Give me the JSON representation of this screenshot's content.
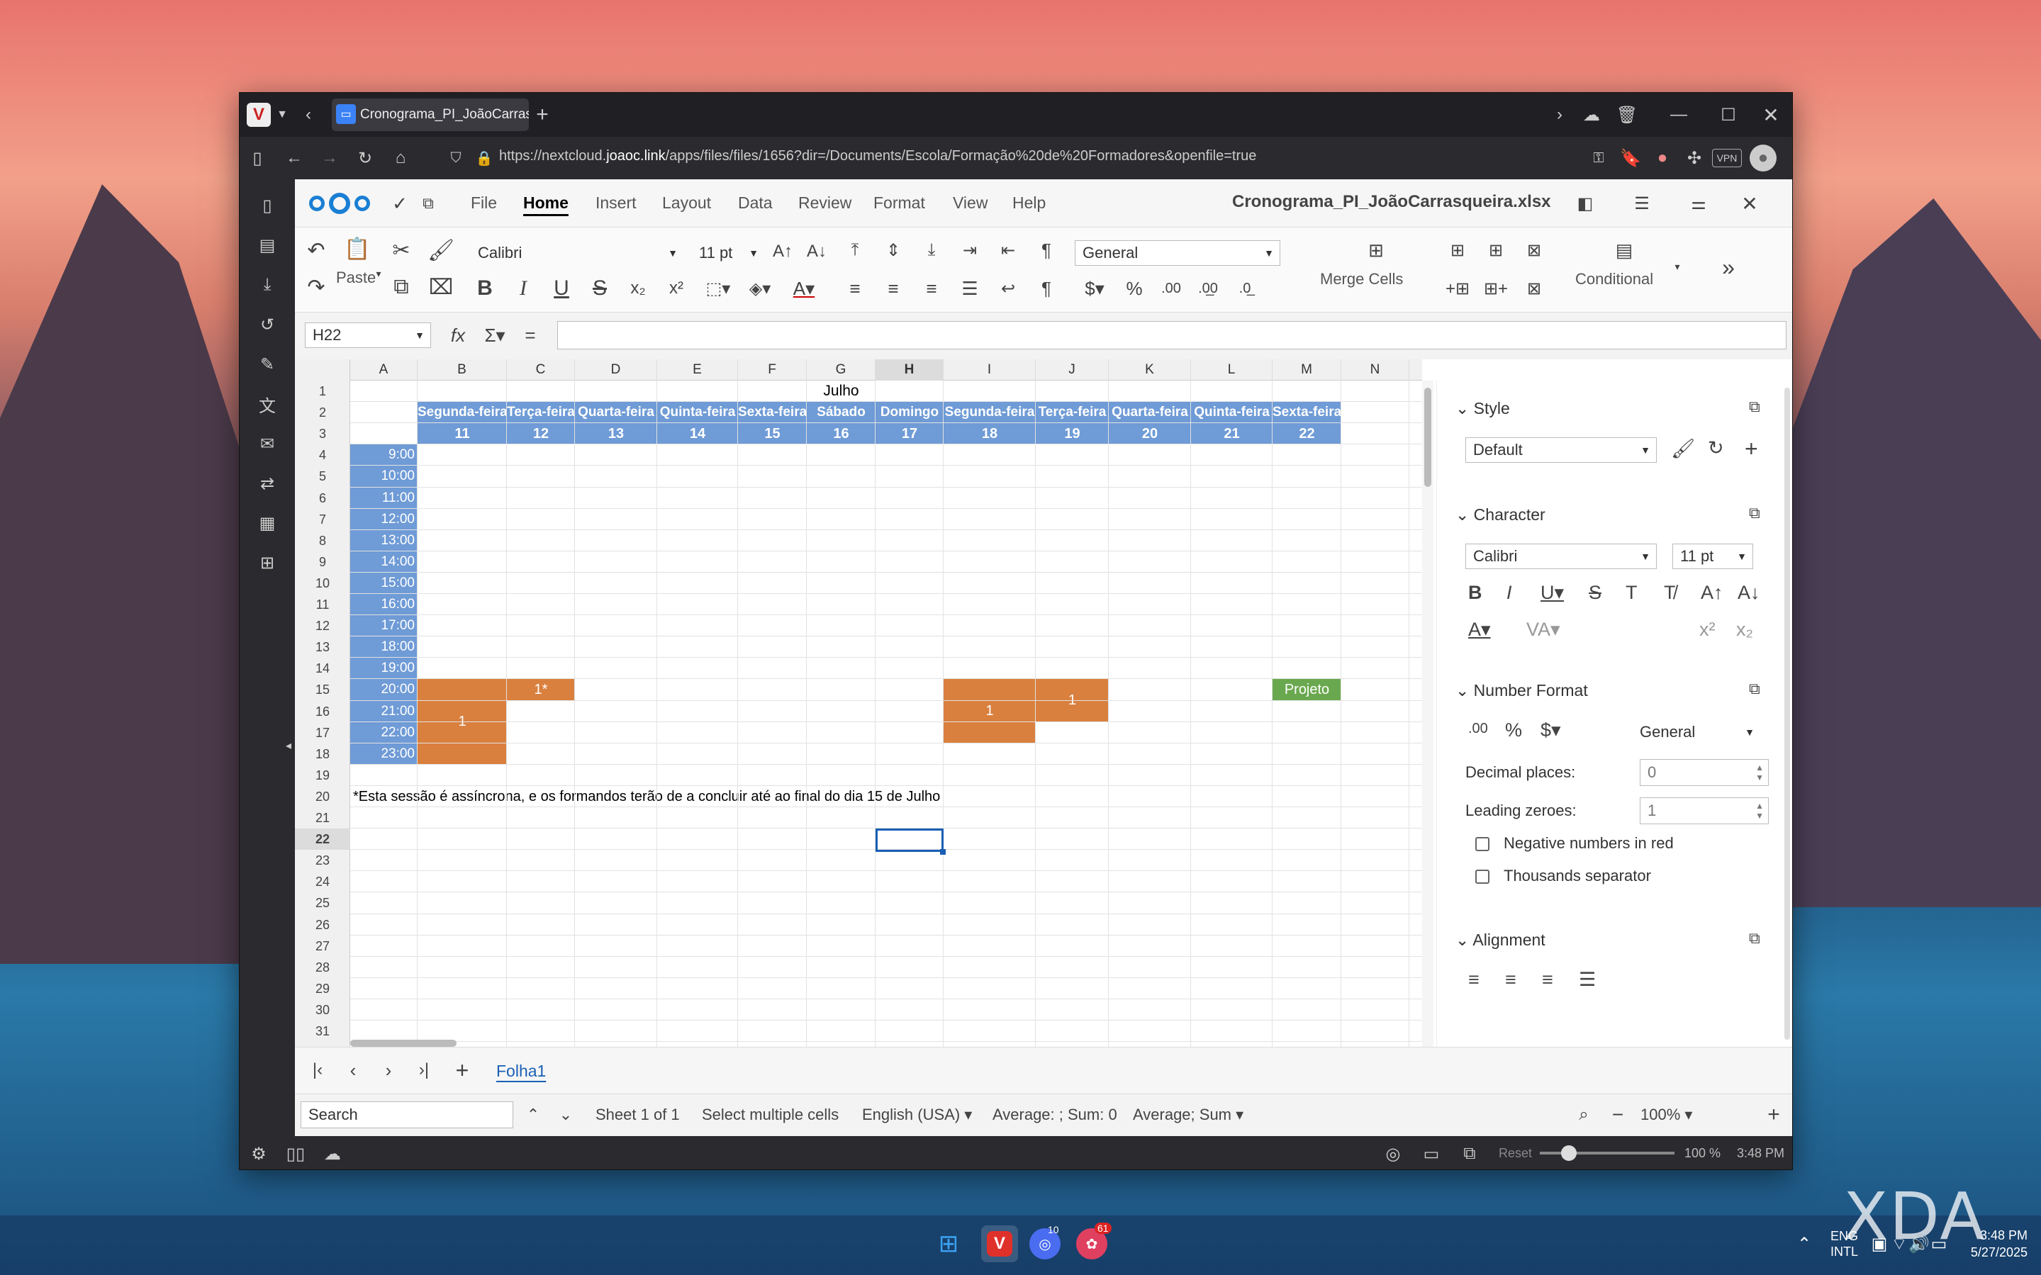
{
  "browser": {
    "tab_title": "Cronograma_PI_JoãoCarrasqu",
    "url_prefix": "https://nextcloud.",
    "url_domain": "joaoc.link",
    "url_rest": "/apps/files/files/1656?dir=/Documents/Escola/Formação%20de%20Formadores&openfile=true",
    "vpn_label": "VPN"
  },
  "app": {
    "doc_title": "Cronograma_PI_JoãoCarrasqueira.xlsx",
    "menu": [
      "File",
      "Home",
      "Insert",
      "Layout",
      "Data",
      "Review",
      "Format",
      "View",
      "Help"
    ],
    "active_menu": "Home"
  },
  "toolbar": {
    "paste_label": "Paste",
    "font_name": "Calibri",
    "font_size": "11 pt",
    "number_format": "General",
    "merge_label": "Merge Cells",
    "conditional_label": "Conditional"
  },
  "formula_bar": {
    "name_box": "H22",
    "formula": ""
  },
  "sheet": {
    "columns": [
      "A",
      "B",
      "C",
      "D",
      "E",
      "F",
      "G",
      "H",
      "I",
      "J",
      "K",
      "L",
      "M",
      "N"
    ],
    "rows": [
      "1",
      "2",
      "3",
      "4",
      "5",
      "6",
      "7",
      "8",
      "9",
      "10",
      "11",
      "12",
      "13",
      "14",
      "15",
      "16",
      "17",
      "18",
      "19",
      "20",
      "21",
      "22",
      "23",
      "24",
      "25",
      "26",
      "27",
      "28",
      "29",
      "30",
      "31"
    ],
    "month_title": "Julho",
    "days": [
      "Segunda-feira",
      "Terça-feira",
      "Quarta-feira",
      "Quinta-feira",
      "Sexta-feira",
      "Sábado",
      "Domingo",
      "Segunda-feira",
      "Terça-feira",
      "Quarta-feira",
      "Quinta-feira",
      "Sexta-feira"
    ],
    "dates": [
      "11",
      "12",
      "13",
      "14",
      "15",
      "16",
      "17",
      "18",
      "19",
      "20",
      "21",
      "22"
    ],
    "times": [
      "9:00",
      "10:00",
      "11:00",
      "12:00",
      "13:00",
      "14:00",
      "15:00",
      "16:00",
      "17:00",
      "18:00",
      "19:00",
      "20:00",
      "21:00",
      "22:00",
      "23:00"
    ],
    "cell_b": "1",
    "cell_c": "1*",
    "cell_i": "1",
    "cell_j": "1",
    "cell_m": "Projeto",
    "note": "*Esta sessão é assíncrona, e os formandos terão de a concluir até ao final do dia 15 de Julho",
    "colors": {
      "blue": "#6f9bd6",
      "orange": "#d9803f",
      "green": "#6aa84f"
    }
  },
  "sheet_tabs": {
    "active": "Folha1"
  },
  "statusbar": {
    "search_placeholder": "Search",
    "sheet_info": "Sheet 1 of 1",
    "selection_mode": "Select multiple cells",
    "language": "English (USA)",
    "stats": "Average: ; Sum: 0",
    "stats_dropdown": "Average; Sum",
    "zoom": "100%"
  },
  "sidebar": {
    "style_title": "Style",
    "style_value": "Default",
    "character_title": "Character",
    "font_name": "Calibri",
    "font_size": "11 pt",
    "number_title": "Number Format",
    "number_value": "General",
    "decimal_label": "Decimal places:",
    "decimal_value": "0",
    "leading_label": "Leading zeroes:",
    "leading_value": "1",
    "neg_red_label": "Negative numbers in red",
    "thousands_label": "Thousands separator",
    "alignment_title": "Alignment"
  },
  "bottom_bar": {
    "reset": "Reset",
    "zoom": "100 %",
    "time": "3:48 PM"
  },
  "taskbar": {
    "lang1": "ENG",
    "lang2": "INTL",
    "time": "3:48 PM",
    "date": "5/27/2025",
    "badge1": "10",
    "badge2": "61",
    "watermark": "XDA"
  }
}
